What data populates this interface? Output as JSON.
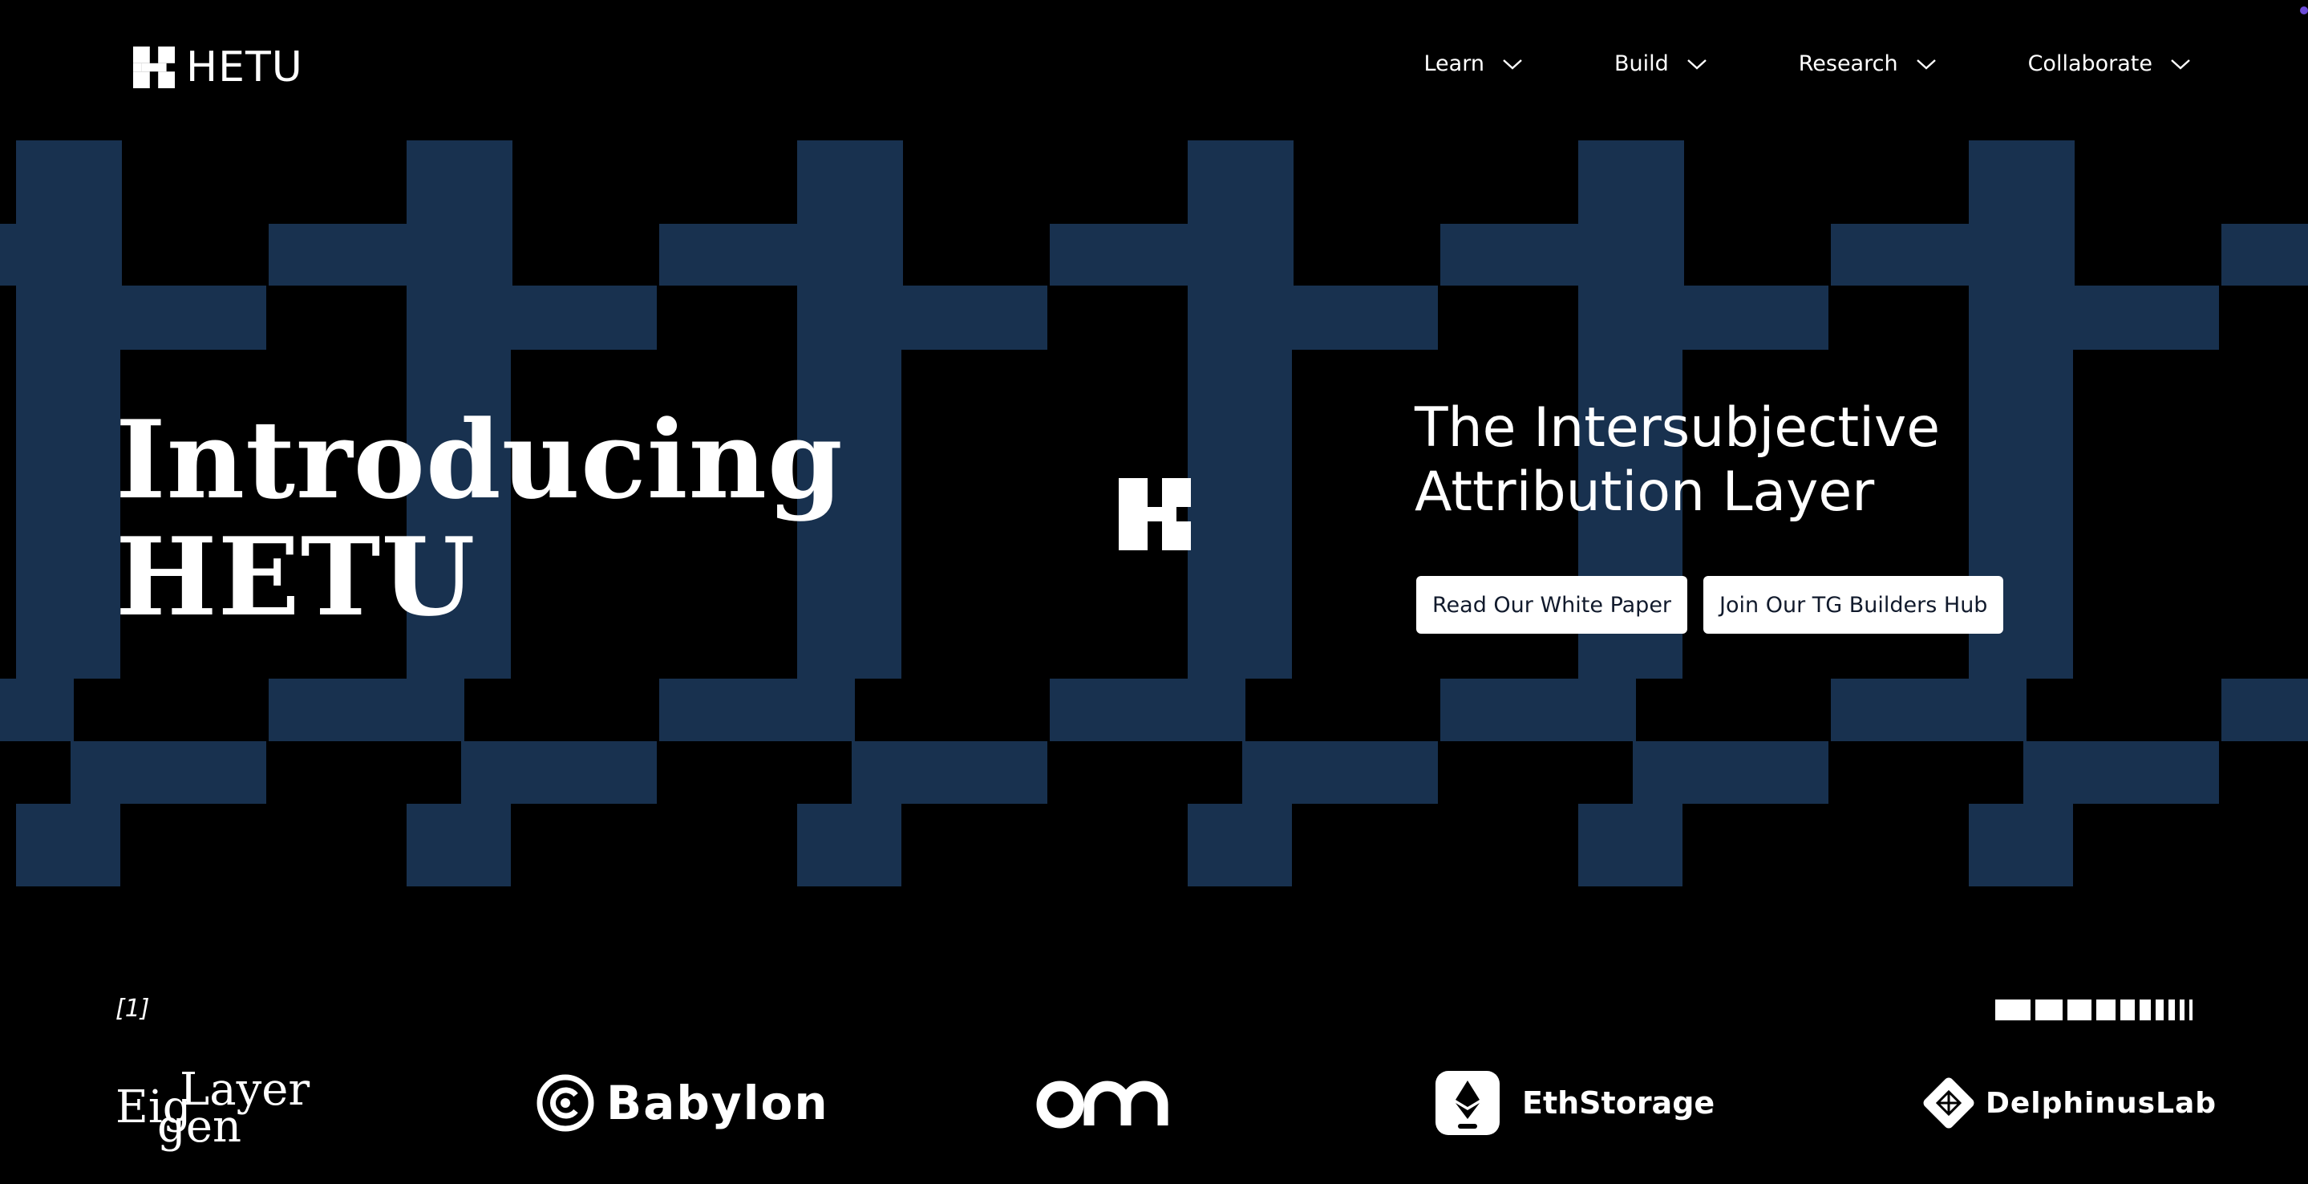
{
  "brand": {
    "name": "HETU"
  },
  "nav": {
    "items": [
      {
        "label": "Learn"
      },
      {
        "label": "Build"
      },
      {
        "label": "Research"
      },
      {
        "label": "Collaborate"
      }
    ]
  },
  "hero": {
    "title_line1": "Introducing",
    "title_line2": "HETU",
    "tagline_line1": "The Intersubjective",
    "tagline_line2": "Attribution Layer",
    "cta_primary": "Read Our White Paper",
    "cta_secondary": "Join Our TG Builders Hub"
  },
  "footnote": "[1]",
  "partners": [
    {
      "name": "EigenLayer",
      "wordmark_top": "Layer",
      "wordmark_mid": "Eig",
      "wordmark_bot": "gen"
    },
    {
      "name": "Babylon",
      "icon": "babylon-logo-icon"
    },
    {
      "name": "ora",
      "icon": "ora-logo-icon"
    },
    {
      "name": "EthStorage",
      "icon": "ethereum-storage-icon"
    },
    {
      "name": "DelphinusLab",
      "icon": "delphinus-diamond-icon"
    }
  ],
  "colors": {
    "background": "#000000",
    "pattern_blue": "#18314f",
    "text": "#ffffff",
    "button_text": "#111a2c",
    "indicator_dot": "#6b4bd8"
  }
}
